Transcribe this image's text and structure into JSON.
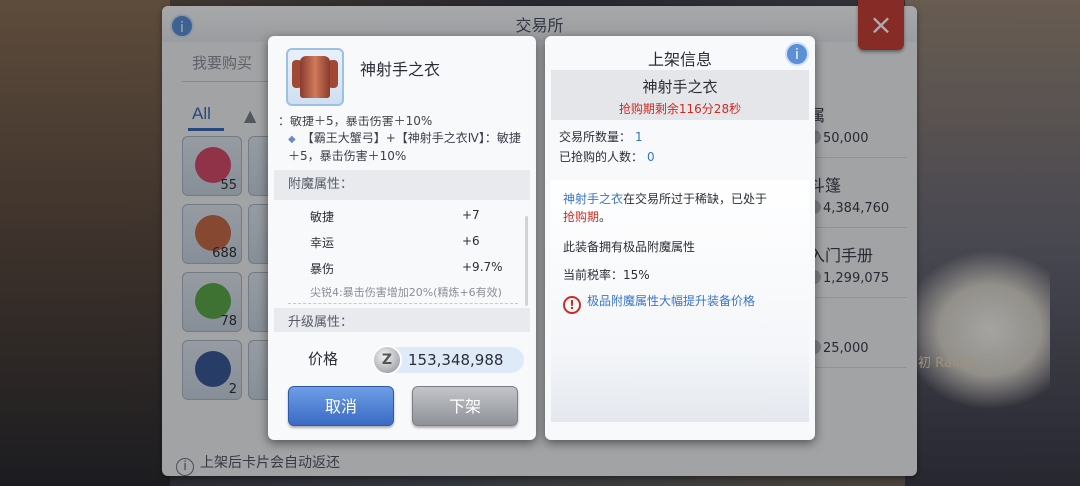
{
  "exchange": {
    "title": "交易所",
    "search_placeholder": "我要购买",
    "tab_all": "All",
    "close_icon": "×",
    "info_icon": "i",
    "footer_text": "上架后卡片会自动返还",
    "items": [
      {
        "qty": "55",
        "color": "#d44a6a"
      },
      {
        "qty": "688",
        "color": "#c86a4a"
      },
      {
        "qty": "78",
        "color": "#5aa84a"
      },
      {
        "qty": "2",
        "color": "#3a5a9a"
      }
    ],
    "listings": [
      {
        "name": "属",
        "price": "50,000"
      },
      {
        "name": "斗篷",
        "price": "4,384,760"
      },
      {
        "name": "入门手册",
        "price": "1,299,075"
      },
      {
        "name": "",
        "price": "25,000"
      }
    ],
    "overlay_text": "初 Rain的"
  },
  "left_panel": {
    "item_name": "神射手之衣",
    "cut_line": "：敏捷＋5，暴击伤害＋10%",
    "set_bonus": "【霸王大蟹弓】+【神射手之衣Ⅳ】：敏捷＋5，暴击伤害＋10%",
    "enchant_header": "附魔属性：",
    "enchants": [
      {
        "name": "敏捷",
        "value": "+7"
      },
      {
        "name": "幸运",
        "value": "+6"
      },
      {
        "name": "暴伤",
        "value": "+9.7%"
      }
    ],
    "enchant_note": "尖锐4:暴击伤害增加20%(精炼+6有效)",
    "upgrade_header": "升级属性：",
    "price_label": "价格",
    "zeny_icon": "Z",
    "price_value": "153,348,988",
    "cancel_label": "取消",
    "delist_label": "下架"
  },
  "right_panel": {
    "title": "上架信息",
    "info_icon": "i",
    "item_name": "神射手之衣",
    "timer": "抢购期剩余116分28秒",
    "exchange_qty_label": "交易所数量：",
    "exchange_qty_value": "1",
    "grab_count_label": "已抢购的人数：",
    "grab_count_value": "0",
    "msg_item": "神射手之衣",
    "msg_mid": "在交易所过于稀缺，已处于",
    "msg_red": "抢购期",
    "msg_end": "。",
    "line_enchant": "此装备拥有极品附魔属性",
    "line_tax": "当前税率：15%",
    "warn_icon": "!",
    "warn_text": "极品附魔属性大幅提升装备价格"
  }
}
